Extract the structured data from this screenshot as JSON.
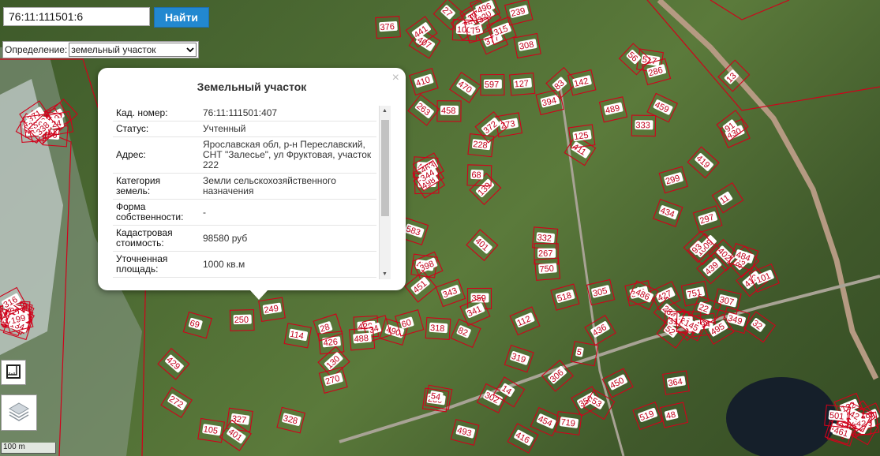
{
  "search": {
    "value": "76:11:111501:6",
    "button_label": "Найти"
  },
  "definition": {
    "label": "Определение:",
    "selected": "земельный участок"
  },
  "popup": {
    "title": "Земельный участок",
    "close_symbol": "×",
    "rows": [
      {
        "key": "Кад. номер:",
        "value": "76:11:111501:407"
      },
      {
        "key": "Статус:",
        "value": "Учтенный"
      },
      {
        "key": "Адрес:",
        "value": "Ярославская обл, р-н Переславский, СНТ \"Залесье\", ул Фруктовая, участок 222"
      },
      {
        "key": "Категория земель:",
        "value": "Земли сельскохозяйственного назначения"
      },
      {
        "key": "Форма собственности:",
        "value": "-"
      },
      {
        "key": "Кадастровая стоимость:",
        "value": "98580 руб"
      },
      {
        "key": "Уточненная площадь:",
        "value": "1000 кв.м"
      }
    ]
  },
  "scale_label": "100 m",
  "colors": {
    "parcel_border": "#d0021b",
    "label_bg": "#ffffff",
    "label_text": "#c0001a",
    "button": "#2288d0"
  },
  "parcel_labels": [
    "374",
    "458",
    "471",
    "459",
    "359",
    "436",
    "350",
    "351",
    "429",
    "428",
    "395",
    "392",
    "393",
    "394",
    "398",
    "430",
    "82",
    "427",
    "306",
    "307",
    "426",
    "127",
    "480",
    "337",
    "407",
    "411",
    "332",
    "489",
    "490",
    "284",
    "230",
    "402",
    "327",
    "406",
    "9",
    "474",
    "377",
    "83",
    "400",
    "11",
    "343",
    "348",
    "302",
    "1009",
    "249",
    "369",
    "464",
    "298",
    "315",
    "470",
    "463",
    "517",
    "318",
    "494",
    "493",
    "349",
    "401",
    "74",
    "86",
    "77",
    "27",
    "273",
    "267",
    "434",
    "420",
    "495",
    "450",
    "331",
    "130",
    "87",
    "414",
    "313",
    "239",
    "228",
    "280",
    "333",
    "451",
    "317",
    "364",
    "439",
    "272",
    "260",
    "481",
    "21",
    "308",
    "125",
    "498",
    "419",
    "60",
    "5",
    "519",
    "484",
    "270",
    "424",
    "268",
    "442",
    "320",
    "263",
    "750",
    "91",
    "112",
    "305",
    "416",
    "413",
    "250",
    "96",
    "373",
    "7",
    "376",
    "410",
    "401",
    "13",
    "14",
    "52",
    "54",
    "751",
    "105",
    "370",
    "371",
    "132",
    "100",
    "142",
    "344",
    "286",
    "34",
    "63",
    "48",
    "101",
    "114",
    "274",
    "256",
    "461",
    "441",
    "372",
    "139",
    "299",
    "488",
    "486",
    "454",
    "145",
    "28",
    "134",
    "24",
    "42",
    "75",
    "127",
    "68",
    "56",
    "341",
    "22",
    "53",
    "93",
    "328",
    "316",
    "338",
    "501",
    "496",
    "597",
    "583",
    "297",
    "319",
    "518",
    "719",
    "32",
    "69",
    "199"
  ],
  "map_controls": {
    "ruler": "ruler-icon",
    "layers": "layers-icon"
  }
}
